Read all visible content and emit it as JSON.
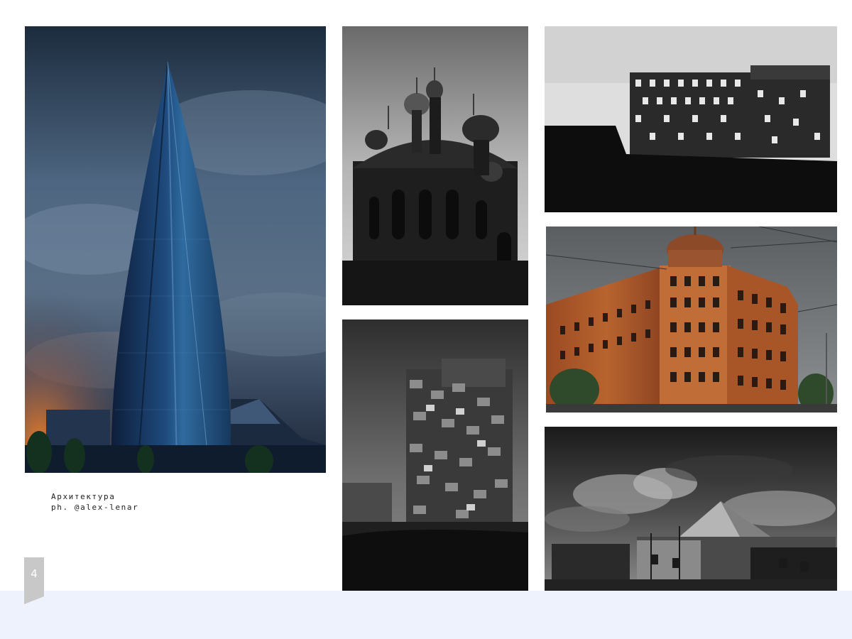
{
  "caption": {
    "line1": "Архитектура",
    "line2": "ph. @alex-lenar"
  },
  "page": {
    "number": "4"
  },
  "colors": {
    "footer_band": "#eef2fc",
    "page_tab": "#c8c8c8"
  }
}
